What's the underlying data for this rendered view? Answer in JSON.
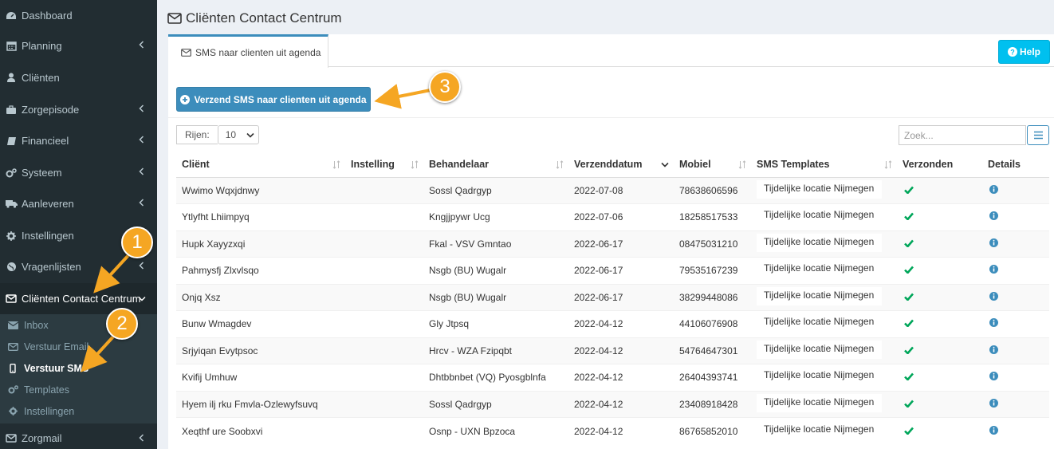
{
  "sidebar": {
    "items": [
      {
        "label": "Dashboard",
        "icon": "dashboard-icon",
        "has_children": false
      },
      {
        "label": "Planning",
        "icon": "calendar-icon",
        "has_children": true
      },
      {
        "label": "Cliënten",
        "icon": "user-icon",
        "has_children": false
      },
      {
        "label": "Zorgepisode",
        "icon": "briefcase-icon",
        "has_children": true
      },
      {
        "label": "Financieel",
        "icon": "book-icon",
        "has_children": true
      },
      {
        "label": "Systeem",
        "icon": "cogs-icon",
        "has_children": true
      },
      {
        "label": "Aanleveren",
        "icon": "truck-icon",
        "has_children": true
      },
      {
        "label": "Instellingen",
        "icon": "gear-icon",
        "has_children": false
      },
      {
        "label": "Vragenlijsten",
        "icon": "globe-icon",
        "has_children": true
      },
      {
        "label": "Cliënten Contact Centrum",
        "icon": "envelope-icon",
        "has_children": true,
        "expanded": true
      },
      {
        "label": "Zorgmail",
        "icon": "envelope-icon",
        "has_children": true
      }
    ],
    "submenu": [
      {
        "label": "Inbox",
        "icon": "envelope-icon"
      },
      {
        "label": "Verstuur Email",
        "icon": "envelope-outline-icon"
      },
      {
        "label": "Verstuur SMS",
        "icon": "mobile-icon",
        "current": true
      },
      {
        "label": "Templates",
        "icon": "cogs-icon"
      },
      {
        "label": "Instellingen",
        "icon": "gear-icon"
      }
    ]
  },
  "header": {
    "title": "Cliënten Contact Centrum"
  },
  "tabs": [
    {
      "label": "SMS naar clienten uit agenda",
      "active": true
    }
  ],
  "help_label": "Help",
  "send_button_label": "Verzend SMS naar clienten uit agenda",
  "rows_control": {
    "label": "Rijen:",
    "selected": "10"
  },
  "search": {
    "placeholder": "Zoek..."
  },
  "table": {
    "columns": [
      "Cliënt",
      "Instelling",
      "Behandelaar",
      "Verzenddatum",
      "Mobiel",
      "SMS Templates",
      "Verzonden",
      "Details"
    ],
    "rows": [
      {
        "client": "Wwimo Wqxjdnwy",
        "instelling": "",
        "behandelaar": "Sossl Qadrgyp",
        "datum": "2022-07-08",
        "mobiel": "78638606596",
        "template": "Tijdelijke locatie Nijmegen"
      },
      {
        "client": "Ytlyfht Lhiimpyq",
        "instelling": "",
        "behandelaar": "Kngjjpywr Ucg",
        "datum": "2022-07-06",
        "mobiel": "18258517533",
        "template": "Tijdelijke locatie Nijmegen"
      },
      {
        "client": "Hupk Xayyzxqi",
        "instelling": "",
        "behandelaar": "Fkal - VSV Gmntao",
        "datum": "2022-06-17",
        "mobiel": "08475031210",
        "template": "Tijdelijke locatie Nijmegen"
      },
      {
        "client": "Pahmysfj Zlxvlsqo",
        "instelling": "",
        "behandelaar": "Nsgb (BU) Wugalr",
        "datum": "2022-06-17",
        "mobiel": "79535167239",
        "template": "Tijdelijke locatie Nijmegen"
      },
      {
        "client": "Onjq Xsz",
        "instelling": "",
        "behandelaar": "Nsgb (BU) Wugalr",
        "datum": "2022-06-17",
        "mobiel": "38299448086",
        "template": "Tijdelijke locatie Nijmegen"
      },
      {
        "client": "Bunw Wmagdev",
        "instelling": "",
        "behandelaar": "Gly Jtpsq",
        "datum": "2022-04-12",
        "mobiel": "44106076908",
        "template": "Tijdelijke locatie Nijmegen"
      },
      {
        "client": "Srjyiqan Evytpsoc",
        "instelling": "",
        "behandelaar": "Hrcv - WZA Fzipqbt",
        "datum": "2022-04-12",
        "mobiel": "54764647301",
        "template": "Tijdelijke locatie Nijmegen"
      },
      {
        "client": "Kvifij Umhuw",
        "instelling": "",
        "behandelaar": "Dhtbbnbet (VQ) Pyosgblnfa",
        "datum": "2022-04-12",
        "mobiel": "26404393741",
        "template": "Tijdelijke locatie Nijmegen"
      },
      {
        "client": "Hyem ilj rku Fmvla-Ozlewyfsuvq",
        "instelling": "",
        "behandelaar": "Sossl Qadrgyp",
        "datum": "2022-04-12",
        "mobiel": "23408918428",
        "template": "Tijdelijke locatie Nijmegen"
      },
      {
        "client": "Xeqthf ure Soobxvi",
        "instelling": "",
        "behandelaar": "Osnp - UXN Bpzoca",
        "datum": "2022-04-12",
        "mobiel": "86765852010",
        "template": "Tijdelijke locatie Nijmegen"
      }
    ]
  },
  "annotations": [
    {
      "number": "1"
    },
    {
      "number": "2"
    },
    {
      "number": "3"
    }
  ],
  "colors": {
    "sidebar_bg": "#222d32",
    "sidebar_text": "#b8c7ce",
    "primary": "#3c8dbc",
    "help": "#00c0ef",
    "success": "#00a65a",
    "annotation": "#f5a623"
  }
}
